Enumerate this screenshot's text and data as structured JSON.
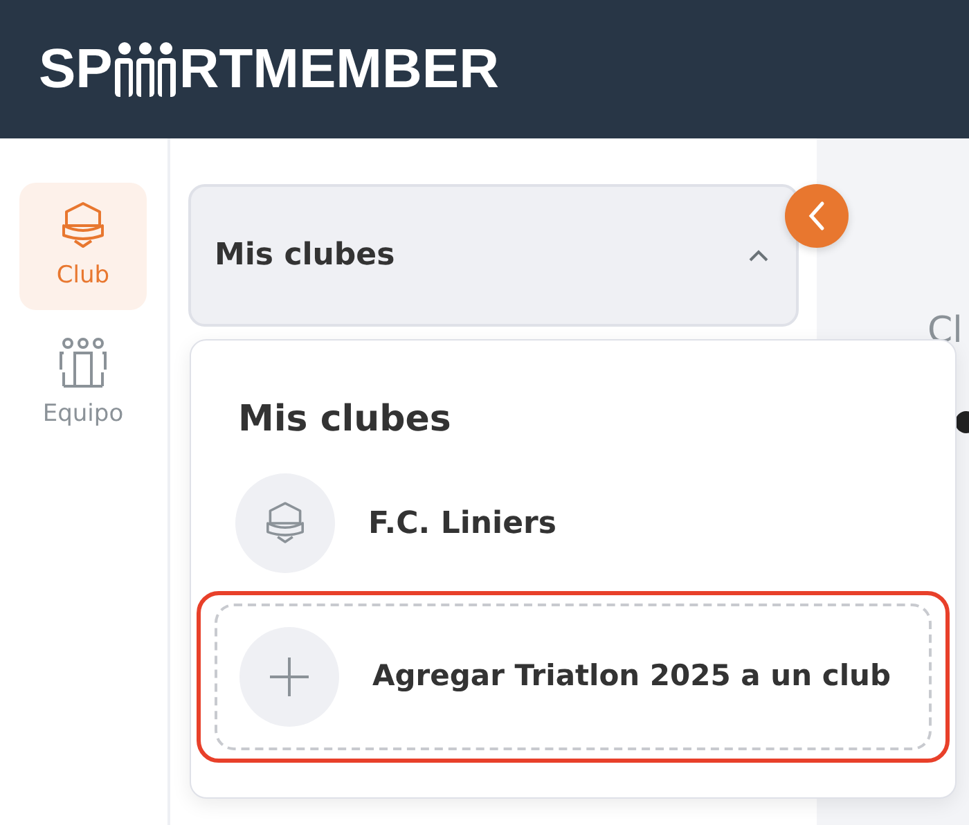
{
  "header": {
    "logo_start": "SP",
    "logo_end": "RTMEMBER"
  },
  "sidebar": {
    "items": [
      {
        "label": "Club",
        "kind": "club",
        "selected": true
      },
      {
        "label": "Equipo",
        "kind": "team",
        "selected": false
      }
    ]
  },
  "club_selector": {
    "label": "Mis clubes",
    "expanded": true,
    "menu": {
      "title": "Mis clubes",
      "items": [
        {
          "label": "F.C. Liniers",
          "kind": "club",
          "highlighted": false
        },
        {
          "label": "Agregar Triatlon 2025 a un club",
          "kind": "add",
          "highlighted": true
        }
      ]
    }
  },
  "content": {
    "heading": "Cl"
  }
}
